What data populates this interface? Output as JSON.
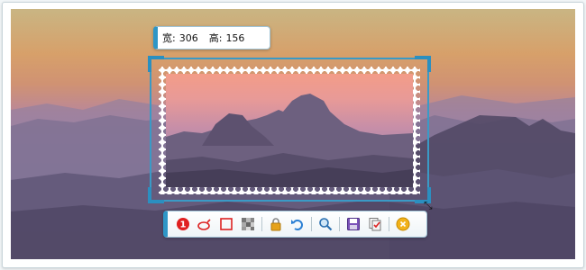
{
  "size_tip": {
    "width_label": "宽:",
    "width_value": "306",
    "height_label": "高:",
    "height_value": "156"
  },
  "toolbar": {
    "tools": [
      {
        "name": "step-number-icon",
        "glyph": "1"
      },
      {
        "name": "ellipse-icon"
      },
      {
        "name": "rectangle-icon"
      },
      {
        "name": "mosaic-icon"
      },
      {
        "name": "lock-icon"
      },
      {
        "name": "undo-icon"
      },
      {
        "name": "zoom-icon"
      },
      {
        "name": "save-icon"
      },
      {
        "name": "copy-icon"
      },
      {
        "name": "close-icon"
      }
    ]
  },
  "colors": {
    "accent": "#2e96c6",
    "selection_border": "#3a9ac6"
  }
}
